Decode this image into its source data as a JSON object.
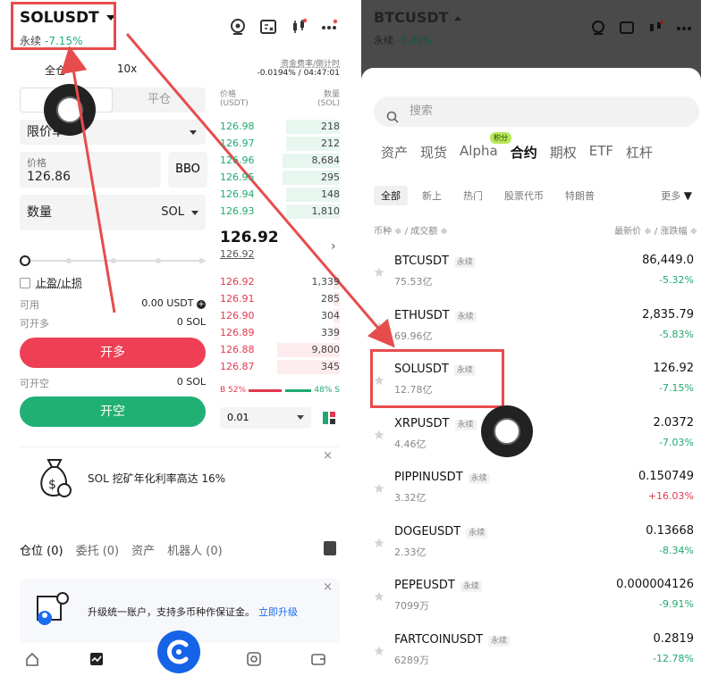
{
  "left": {
    "symbol": "SOLUSDT",
    "contract_type": "永续",
    "change": "-7.15%",
    "funding_label": "资金费率/倒计时",
    "funding_value": "-0.0194% / 04:47:01",
    "margin_mode": "全仓",
    "leverage": "10x",
    "close_tab": "平仓",
    "order_type": "限价单",
    "price_label": "价格",
    "price_value": "126.86",
    "bbo_label": "BBO",
    "qty_label": "数量",
    "qty_unit": "SOL",
    "tpsl_label": "止盈/止损",
    "available_label": "可用",
    "available_value": "0.00 USDT",
    "can_long_label": "可开多",
    "can_long_value": "0 SOL",
    "long_button": "开多",
    "can_short_label": "可开空",
    "can_short_value": "0 SOL",
    "short_button": "开空",
    "orderbook": {
      "price_header": "价格\n(USDT)",
      "price_header_1": "价格",
      "price_header_2": "(USDT)",
      "qty_header_1": "数量",
      "qty_header_2": "(SOL)",
      "bids": [
        {
          "price": "126.98",
          "qty": "218",
          "depth": 0.45
        },
        {
          "price": "126.97",
          "qty": "212",
          "depth": 0.45
        },
        {
          "price": "126.96",
          "qty": "8,684",
          "depth": 0.48
        },
        {
          "price": "126.95",
          "qty": "295",
          "depth": 0.48
        },
        {
          "price": "126.94",
          "qty": "148",
          "depth": 0.45
        },
        {
          "price": "126.93",
          "qty": "1,810",
          "depth": 0.45
        }
      ],
      "mid_price": "126.92",
      "mid_sub": "126.92",
      "asks": [
        {
          "price": "126.92",
          "qty": "1,339",
          "depth": 0.05
        },
        {
          "price": "126.91",
          "qty": "285",
          "depth": 0.05
        },
        {
          "price": "126.90",
          "qty": "304",
          "depth": 0.05
        },
        {
          "price": "126.89",
          "qty": "339",
          "depth": 0.05
        },
        {
          "price": "126.88",
          "qty": "9,800",
          "depth": 0.52
        },
        {
          "price": "126.87",
          "qty": "345",
          "depth": 0.52
        }
      ],
      "buy_ratio": "B 52%",
      "sell_ratio": "48% S",
      "buy_ratio_value": 52,
      "depth": "0.01"
    },
    "banner_text": "SOL 挖矿年化利率高达 16%",
    "position_tabs": [
      "仓位 (0)",
      "委托 (0)",
      "资产",
      "机器人 (0)"
    ],
    "upgrade_text": "升级统一账户，支持多币种作保证金。",
    "upgrade_link": "立即升级"
  },
  "right": {
    "symbol": "BTCUSDT",
    "contract_type": "永续",
    "change": "-5.32%",
    "search_placeholder": "搜索",
    "category_tabs": [
      "资产",
      "现货",
      "Alpha",
      "合约",
      "期权",
      "ETF",
      "杠杆"
    ],
    "alpha_badge": "积分",
    "sub_tabs": [
      "全部",
      "新上",
      "热门",
      "股票代币",
      "特朗普"
    ],
    "more_label": "更多",
    "col_left": "币种 ≑ / 成交额 ≑",
    "col_right": "最新价 ≑ / 涨跌幅 ≑",
    "rows": [
      {
        "symbol": "BTCUSDT",
        "tag": "永续",
        "volume": "75.53亿",
        "price": "86,449.0",
        "change": "-5.32%",
        "dir": "neg"
      },
      {
        "symbol": "ETHUSDT",
        "tag": "永续",
        "volume": "69.96亿",
        "price": "2,835.79",
        "change": "-5.83%",
        "dir": "neg"
      },
      {
        "symbol": "SOLUSDT",
        "tag": "永续",
        "volume": "12.78亿",
        "price": "126.92",
        "change": "-7.15%",
        "dir": "neg"
      },
      {
        "symbol": "XRPUSDT",
        "tag": "永续",
        "volume": "4.46亿",
        "price": "2.0372",
        "change": "-7.03%",
        "dir": "neg"
      },
      {
        "symbol": "PIPPINUSDT",
        "tag": "永续",
        "volume": "3.32亿",
        "price": "0.150749",
        "change": "+16.03%",
        "dir": "pos"
      },
      {
        "symbol": "DOGEUSDT",
        "tag": "永续",
        "volume": "2.33亿",
        "price": "0.13668",
        "change": "-8.34%",
        "dir": "neg"
      },
      {
        "symbol": "PEPEUSDT",
        "tag": "永续",
        "volume": "7099万",
        "price": "0.000004126",
        "change": "-9.91%",
        "dir": "neg"
      },
      {
        "symbol": "FARTCOINUSDT",
        "tag": "永续",
        "volume": "6289万",
        "price": "0.2819",
        "change": "-12.78%",
        "dir": "neg"
      }
    ]
  },
  "colors": {
    "annotation": "#e74c4c",
    "up": "#1fa870",
    "down": "#e0394e",
    "brand": "#1763e8"
  }
}
